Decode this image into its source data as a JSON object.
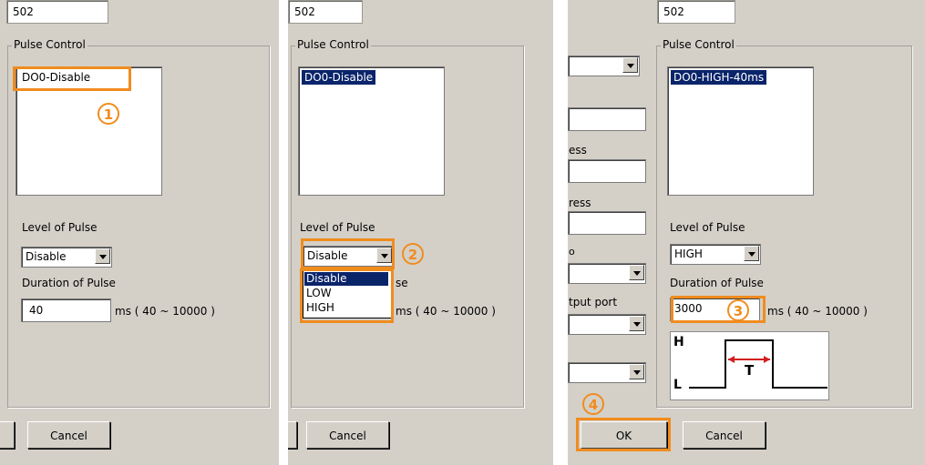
{
  "panel1": {
    "top_value": "502",
    "group_legend": "Pulse Control",
    "list_item": "DO0-Disable",
    "level_label": "Level of Pulse",
    "level_value": "Disable",
    "duration_label": "Duration of Pulse",
    "duration_value": "40",
    "range_text": "ms ( 40 ~ 10000 )",
    "cancel_label": "Cancel",
    "step_badge": "1"
  },
  "panel2": {
    "top_value": "502",
    "group_legend": "Pulse Control",
    "list_item": "DO0-Disable",
    "level_label": "Level of Pulse",
    "level_value": "Disable",
    "options": [
      "Disable",
      "LOW",
      "HIGH"
    ],
    "hidden_fragment": "se",
    "range_text": "ms ( 40 ~ 10000 )",
    "cancel_label": "Cancel",
    "step_badge": "2"
  },
  "panel3": {
    "top_value": "502",
    "group_legend": "Pulse Control",
    "list_item": "DO0-HIGH-40ms",
    "level_label": "Level of Pulse",
    "level_value": "HIGH",
    "duration_label": "Duration of Pulse",
    "duration_value": "3000",
    "range_text": "ms ( 40 ~ 10000 )",
    "waveform": {
      "high_label": "H",
      "low_label": "L",
      "period_label": "T"
    },
    "left_fragments": [
      "ess",
      "ress",
      "tput port"
    ],
    "ok_label": "OK",
    "cancel_label": "Cancel",
    "step_badge_3": "3",
    "step_badge_4": "4"
  },
  "colors": {
    "highlight": "#f08c1e",
    "selection": "#0a246a",
    "dialog_bg": "#d4d0c8"
  }
}
